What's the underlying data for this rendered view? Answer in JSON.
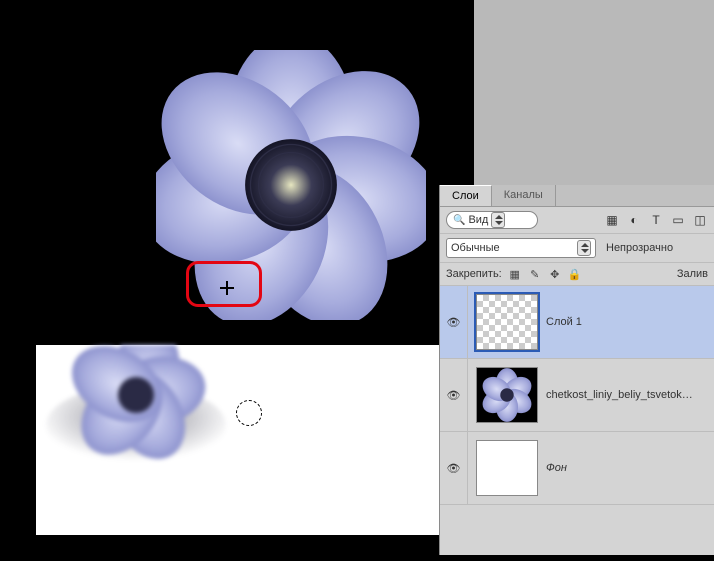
{
  "canvas": {
    "crosshair_target": "brush-crosshair",
    "brush_circle": "brush-outline"
  },
  "panel": {
    "tabs": {
      "layers": "Слои",
      "channels": "Каналы"
    },
    "filter_label": "Вид",
    "icons": {
      "image": "image-adjust-icon",
      "adjustment": "adjustment-icon",
      "type": "T",
      "shape": "shape-icon",
      "smart": "smart-object-icon",
      "menu": "menu-icon"
    },
    "blend_mode": "Обычные",
    "opacity_label": "Непрозрачно",
    "lock_label": "Закрепить:",
    "fill_label": "Залив"
  },
  "layers": [
    {
      "name": "Слой 1",
      "visible": true,
      "selected": true,
      "thumb": "checker",
      "italic": false
    },
    {
      "name": "chetkost_liniy_beliy_tsvetok_na",
      "visible": true,
      "selected": false,
      "thumb": "flower",
      "italic": false
    },
    {
      "name": "Фон",
      "visible": true,
      "selected": false,
      "thumb": "white",
      "italic": true
    }
  ]
}
